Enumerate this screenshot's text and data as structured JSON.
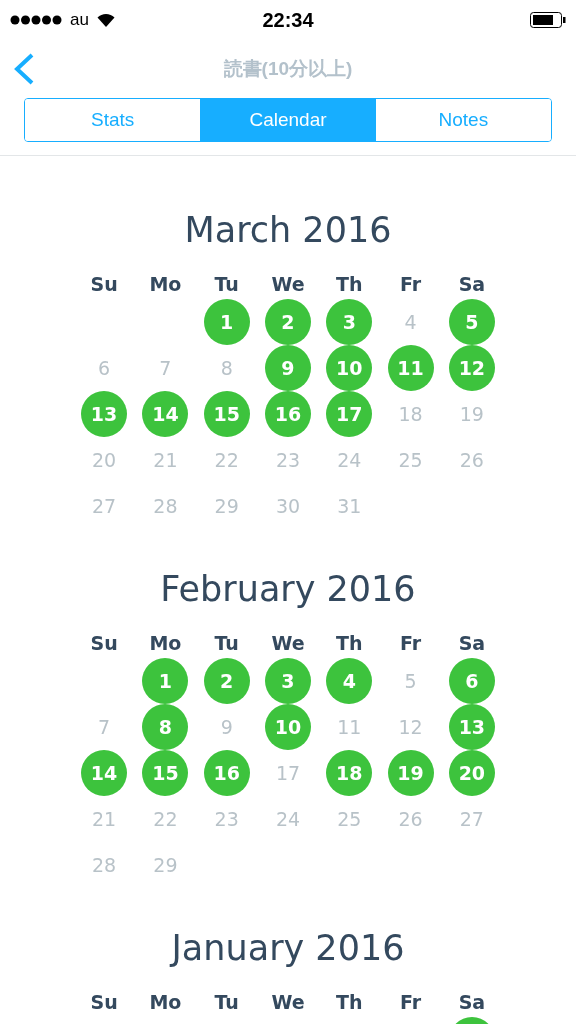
{
  "status_bar": {
    "carrier": "au",
    "time": "22:34"
  },
  "nav": {
    "title": "読書(10分以上)"
  },
  "tabs": [
    {
      "label": "Stats",
      "selected": false
    },
    {
      "label": "Calendar",
      "selected": true
    },
    {
      "label": "Notes",
      "selected": false
    }
  ],
  "months": [
    {
      "title": "March 2016",
      "weekdays": [
        "Su",
        "Mo",
        "Tu",
        "We",
        "Th",
        "Fr",
        "Sa"
      ],
      "weeks": [
        [
          {
            "kind": "blank"
          },
          {
            "kind": "blank"
          },
          {
            "kind": "day",
            "day": "1",
            "done": true
          },
          {
            "kind": "day",
            "day": "2",
            "done": true
          },
          {
            "kind": "day",
            "day": "3",
            "done": true
          },
          {
            "kind": "day",
            "day": "4",
            "done": false
          },
          {
            "kind": "day",
            "day": "5",
            "done": true
          }
        ],
        [
          {
            "kind": "day",
            "day": "6",
            "done": false
          },
          {
            "kind": "day",
            "day": "7",
            "done": false
          },
          {
            "kind": "day",
            "day": "8",
            "done": false
          },
          {
            "kind": "day",
            "day": "9",
            "done": true
          },
          {
            "kind": "day",
            "day": "10",
            "done": true
          },
          {
            "kind": "day",
            "day": "11",
            "done": true
          },
          {
            "kind": "day",
            "day": "12",
            "done": true
          }
        ],
        [
          {
            "kind": "day",
            "day": "13",
            "done": true
          },
          {
            "kind": "day",
            "day": "14",
            "done": true
          },
          {
            "kind": "day",
            "day": "15",
            "done": true
          },
          {
            "kind": "day",
            "day": "16",
            "done": true
          },
          {
            "kind": "day",
            "day": "17",
            "done": true
          },
          {
            "kind": "day",
            "day": "18",
            "done": false
          },
          {
            "kind": "day",
            "day": "19",
            "done": false
          }
        ],
        [
          {
            "kind": "day",
            "day": "20",
            "done": false
          },
          {
            "kind": "day",
            "day": "21",
            "done": false
          },
          {
            "kind": "day",
            "day": "22",
            "done": false
          },
          {
            "kind": "day",
            "day": "23",
            "done": false
          },
          {
            "kind": "day",
            "day": "24",
            "done": false
          },
          {
            "kind": "day",
            "day": "25",
            "done": false
          },
          {
            "kind": "day",
            "day": "26",
            "done": false
          }
        ],
        [
          {
            "kind": "day",
            "day": "27",
            "done": false
          },
          {
            "kind": "day",
            "day": "28",
            "done": false
          },
          {
            "kind": "day",
            "day": "29",
            "done": false
          },
          {
            "kind": "day",
            "day": "30",
            "done": false
          },
          {
            "kind": "day",
            "day": "31",
            "done": false
          }
        ]
      ]
    },
    {
      "title": "February 2016",
      "weekdays": [
        "Su",
        "Mo",
        "Tu",
        "We",
        "Th",
        "Fr",
        "Sa"
      ],
      "weeks": [
        [
          {
            "kind": "blank"
          },
          {
            "kind": "day",
            "day": "1",
            "done": true
          },
          {
            "kind": "day",
            "day": "2",
            "done": true
          },
          {
            "kind": "day",
            "day": "3",
            "done": true
          },
          {
            "kind": "day",
            "day": "4",
            "done": true
          },
          {
            "kind": "day",
            "day": "5",
            "done": false
          },
          {
            "kind": "day",
            "day": "6",
            "done": true
          }
        ],
        [
          {
            "kind": "day",
            "day": "7",
            "done": false
          },
          {
            "kind": "day",
            "day": "8",
            "done": true
          },
          {
            "kind": "day",
            "day": "9",
            "done": false
          },
          {
            "kind": "day",
            "day": "10",
            "done": true
          },
          {
            "kind": "day",
            "day": "11",
            "done": false
          },
          {
            "kind": "day",
            "day": "12",
            "done": false
          },
          {
            "kind": "day",
            "day": "13",
            "done": true
          }
        ],
        [
          {
            "kind": "day",
            "day": "14",
            "done": true
          },
          {
            "kind": "day",
            "day": "15",
            "done": true
          },
          {
            "kind": "day",
            "day": "16",
            "done": true
          },
          {
            "kind": "day",
            "day": "17",
            "done": false
          },
          {
            "kind": "day",
            "day": "18",
            "done": true
          },
          {
            "kind": "day",
            "day": "19",
            "done": true
          },
          {
            "kind": "day",
            "day": "20",
            "done": true
          }
        ],
        [
          {
            "kind": "day",
            "day": "21",
            "done": false
          },
          {
            "kind": "day",
            "day": "22",
            "done": false
          },
          {
            "kind": "day",
            "day": "23",
            "done": false
          },
          {
            "kind": "day",
            "day": "24",
            "done": false
          },
          {
            "kind": "day",
            "day": "25",
            "done": false
          },
          {
            "kind": "day",
            "day": "26",
            "done": false
          },
          {
            "kind": "day",
            "day": "27",
            "done": false
          }
        ],
        [
          {
            "kind": "day",
            "day": "28",
            "done": false
          },
          {
            "kind": "day",
            "day": "29",
            "done": false
          }
        ]
      ]
    },
    {
      "title": "January 2016",
      "weekdays": [
        "Su",
        "Mo",
        "Tu",
        "We",
        "Th",
        "Fr",
        "Sa"
      ],
      "weeks": [
        [
          {
            "kind": "blank"
          },
          {
            "kind": "blank"
          },
          {
            "kind": "blank"
          },
          {
            "kind": "blank"
          },
          {
            "kind": "blank"
          },
          {
            "kind": "blank"
          },
          {
            "kind": "day",
            "done": true
          }
        ]
      ]
    }
  ]
}
